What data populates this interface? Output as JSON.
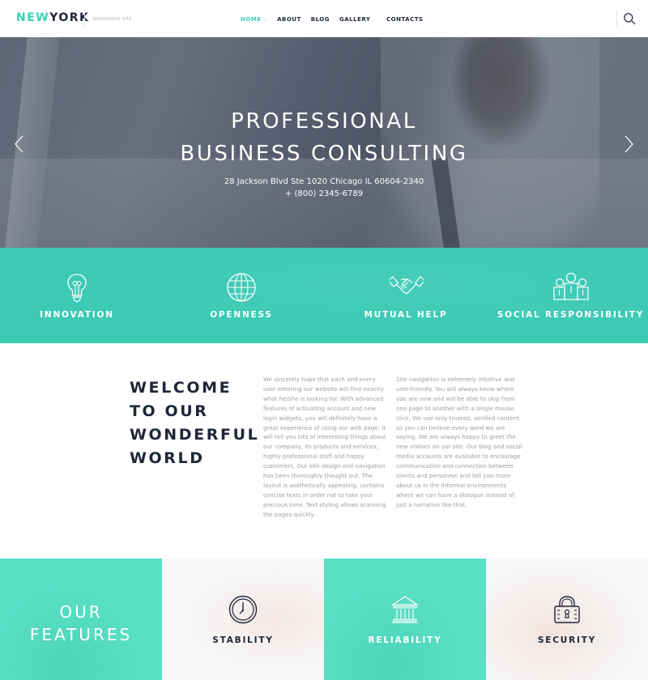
{
  "header": {
    "logo": {
      "part1": "NEW",
      "part2": "YORK"
    },
    "tagline": "WORDPRESS SITE",
    "nav": [
      {
        "label": "HOME",
        "active": true,
        "has_dropdown": true
      },
      {
        "label": "ABOUT",
        "active": false,
        "has_dropdown": false
      },
      {
        "label": "BLOG",
        "active": false,
        "has_dropdown": false
      },
      {
        "label": "GALLERY",
        "active": false,
        "has_dropdown": true
      },
      {
        "label": "CONTACTS",
        "active": false,
        "has_dropdown": false
      }
    ],
    "search_icon": "search-icon"
  },
  "hero": {
    "title_line1": "PROFESSIONAL",
    "title_line2": "BUSINESS CONSULTING",
    "address": "28 Jackson Blvd Ste 1020 Chicago IL 60604-2340",
    "phone": "+ (800) 2345-6789",
    "prev_icon": "chevron-left-icon",
    "next_icon": "chevron-right-icon"
  },
  "values": [
    {
      "label": "INNOVATION",
      "icon": "lightbulb-icon"
    },
    {
      "label": "OPENNESS",
      "icon": "globe-icon"
    },
    {
      "label": "MUTUAL HELP",
      "icon": "handshake-icon"
    },
    {
      "label": "SOCIAL RESPONSIBILITY",
      "icon": "team-icon"
    }
  ],
  "welcome": {
    "title_lines": [
      "WELCOME",
      "TO OUR",
      "WONDERFUL",
      "WORLD"
    ],
    "col1": "We sincerely hope that each and every user entering our website will find exactly what he/she is looking for. With advanced features of activating account and new login widgets, you will definitely have a great experience of using our web page. It will tell you lots of interesting things about our company, its products and services, highly professional staff and happy customers. Our site design and navigation has been thoroughly thought out. The layout is aesthetically appealing, contains concise texts in order not to take your precious time. Text styling allows scanning the pages quickly.",
    "col2": "Site navigation is extremely intuitive and user-friendly. You will always know where you are now and will be able to skip from one page to another with a single mouse click. We use only trusted, verified content, so you can believe every word we are saying. We are always happy to greet the new visitors on our site. Our blog and social media accounts are available to encourage communication and connection between clients and personnel and tell you more about us in the informal environments where we can have a dialogue instead of just a narrative like that."
  },
  "features": {
    "title_line1": "OUR",
    "title_line2": "FEATURES",
    "items": [
      {
        "label": "STABILITY",
        "icon": "clock-icon"
      },
      {
        "label": "RELIABILITY",
        "icon": "bank-icon"
      },
      {
        "label": "SECURITY",
        "icon": "padlock-icon"
      }
    ]
  },
  "colors": {
    "accent": "#3ad1b7",
    "values_band": "#3ccab4",
    "features_teal": "#5ae0c5",
    "dark_text": "#1e2637",
    "body_text": "#9aa0aa"
  }
}
